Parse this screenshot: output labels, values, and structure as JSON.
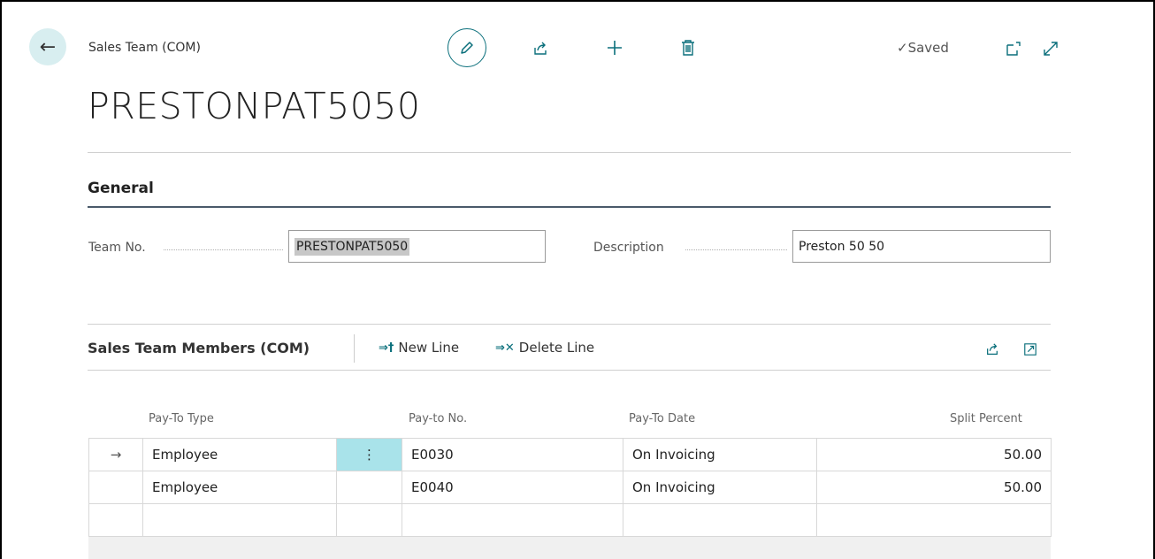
{
  "header": {
    "back_icon": "arrow-left-icon",
    "breadcrumb": "Sales Team (COM)",
    "title": "PRESTONPAT5050",
    "status": "Saved",
    "icons": [
      "edit-icon",
      "share-icon",
      "plus-icon",
      "delete-icon",
      "open-new-window-icon",
      "expand-icon"
    ]
  },
  "general": {
    "section_title": "General",
    "team_no_label": "Team No.",
    "team_no_value": "PRESTONPAT5050",
    "description_label": "Description",
    "description_value": "Preston 50 50"
  },
  "members": {
    "title": "Sales Team Members (COM)",
    "new_line_label": "New Line",
    "delete_line_label": "Delete Line",
    "columns": [
      "Pay-To Type",
      "Pay-to No.",
      "Pay-To Date",
      "Split Percent"
    ],
    "rows": [
      {
        "pay_to_type": "Employee",
        "pay_to_no": "E0030",
        "pay_to_date": "On Invoicing",
        "split_percent": "50.00"
      },
      {
        "pay_to_type": "Employee",
        "pay_to_no": "E0040",
        "pay_to_date": "On Invoicing",
        "split_percent": "50.00"
      }
    ]
  },
  "colors": {
    "accent": "#0a6f7b",
    "selected_cell": "#a9e3ea",
    "back_button_bg": "#d8eef0"
  }
}
